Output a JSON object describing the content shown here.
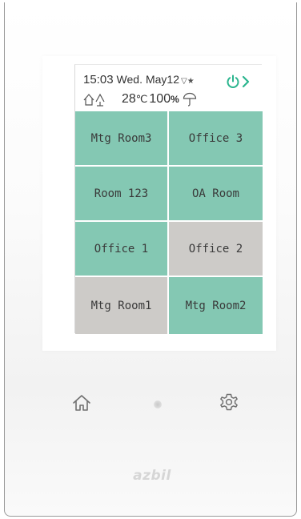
{
  "status_bar": {
    "time": "15:03",
    "day": "Wed.",
    "date": "May12",
    "marks": "▽★",
    "temperature": "28",
    "temperature_unit": "℃",
    "humidity": "100",
    "humidity_unit": "%"
  },
  "rooms": [
    {
      "label": "Mtg Room3",
      "state": "on"
    },
    {
      "label": "Office 3",
      "state": "on"
    },
    {
      "label": "Room 123",
      "state": "on"
    },
    {
      "label": "OA Room",
      "state": "on"
    },
    {
      "label": "Office 1",
      "state": "on"
    },
    {
      "label": "Office 2",
      "state": "off"
    },
    {
      "label": "Mtg Room1",
      "state": "off"
    },
    {
      "label": "Mtg Room2",
      "state": "on"
    }
  ],
  "colors": {
    "on": "#84c8b3",
    "off": "#cdcbc8",
    "accent": "#2bb58e",
    "text": "#3a3a3a"
  },
  "icons": {
    "power": "power-icon",
    "next": "chevron-right-icon",
    "outdoor": "house-tree-icon",
    "weather": "umbrella-icon",
    "home": "home-icon",
    "settings": "gear-icon"
  },
  "device": {
    "brand": "azbil"
  }
}
